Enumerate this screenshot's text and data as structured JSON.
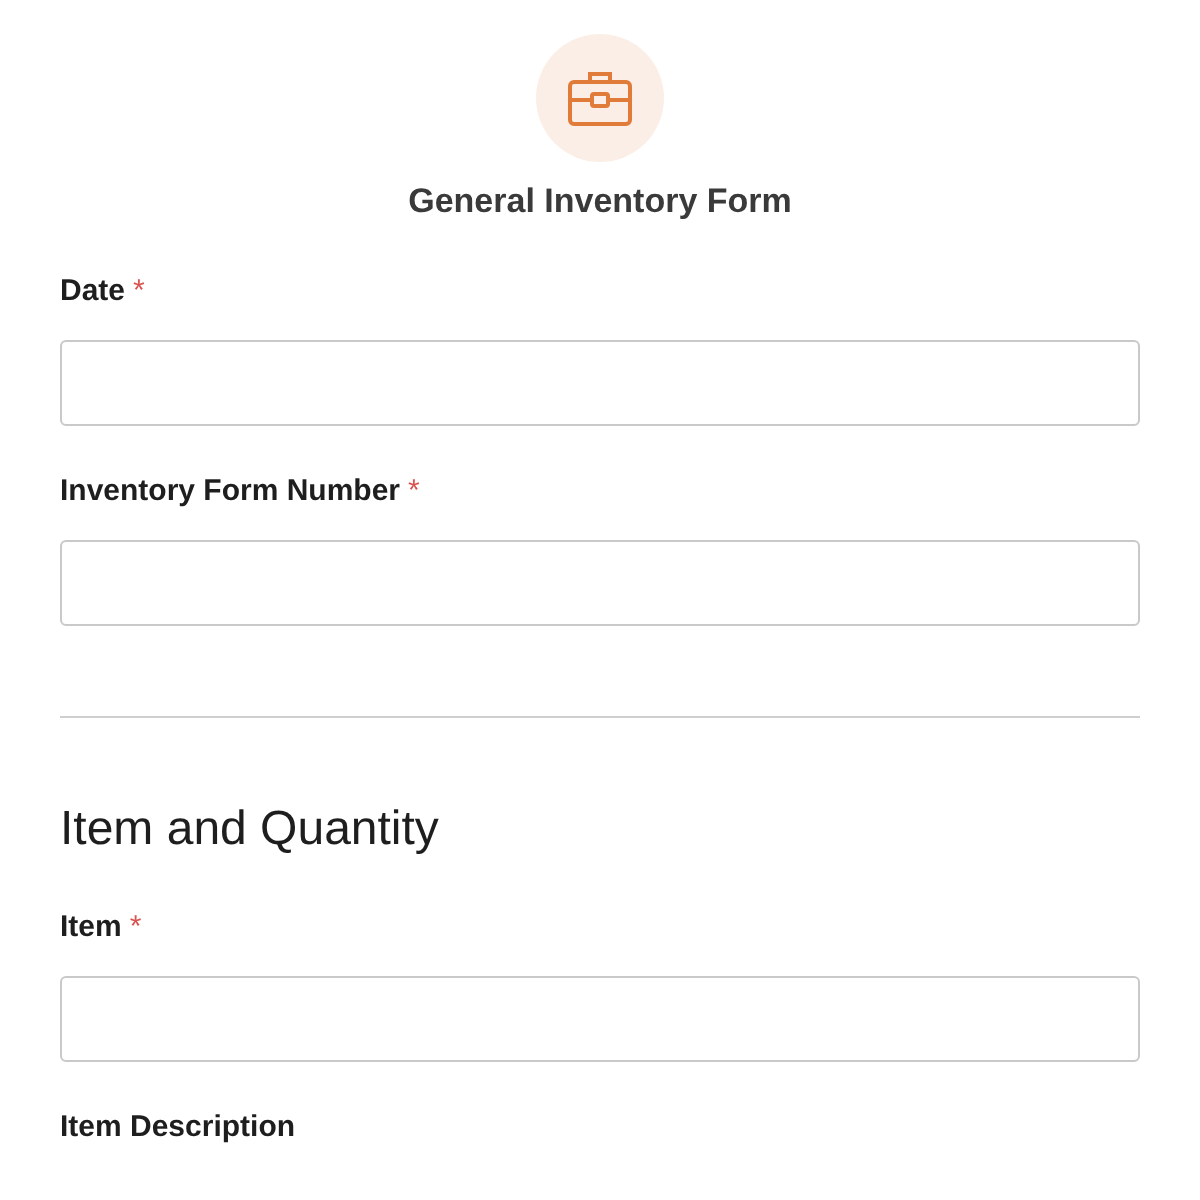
{
  "form": {
    "title": "General Inventory Form"
  },
  "items": [
    {
      "kind": "field",
      "label": "Date",
      "required_mark": "*"
    },
    {
      "kind": "field",
      "label": "Inventory Form Number",
      "required_mark": "*"
    },
    {
      "kind": "divider"
    },
    {
      "kind": "heading",
      "text": "Item and Quantity"
    },
    {
      "kind": "field",
      "label": "Item",
      "required_mark": "*"
    },
    {
      "kind": "label",
      "label": "Item Description"
    }
  ]
}
